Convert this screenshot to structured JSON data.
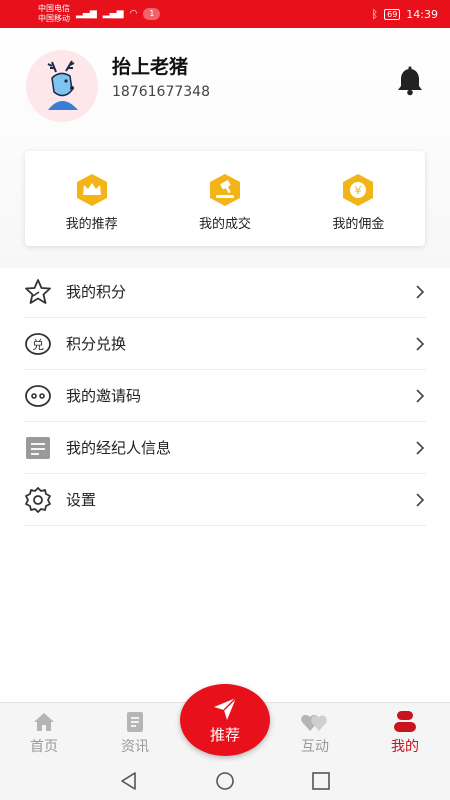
{
  "status_bar": {
    "carrier1": "中国电信",
    "carrier2": "中国移动",
    "notification_count": "1",
    "battery": "69",
    "time": "14:39"
  },
  "profile": {
    "name": "抬上老猪",
    "phone": "18761677348"
  },
  "quick_actions": [
    {
      "label": "我的推荐",
      "icon": "crown-icon"
    },
    {
      "label": "我的成交",
      "icon": "gavel-icon"
    },
    {
      "label": "我的佣金",
      "icon": "yen-icon"
    }
  ],
  "menu": [
    {
      "label": "我的积分",
      "icon": "star-icon"
    },
    {
      "label": "积分兑换",
      "icon": "exchange-icon"
    },
    {
      "label": "我的邀请码",
      "icon": "chat-bubble-icon"
    },
    {
      "label": "我的经纪人信息",
      "icon": "document-icon"
    },
    {
      "label": "设置",
      "icon": "gear-icon"
    }
  ],
  "tabbar": {
    "home": "首页",
    "news": "资讯",
    "recommend": "推荐",
    "interact": "互动",
    "mine": "我的"
  },
  "colors": {
    "brand_red": "#e8101a",
    "active_tab": "#c8141c",
    "gold": "#f2b417"
  }
}
